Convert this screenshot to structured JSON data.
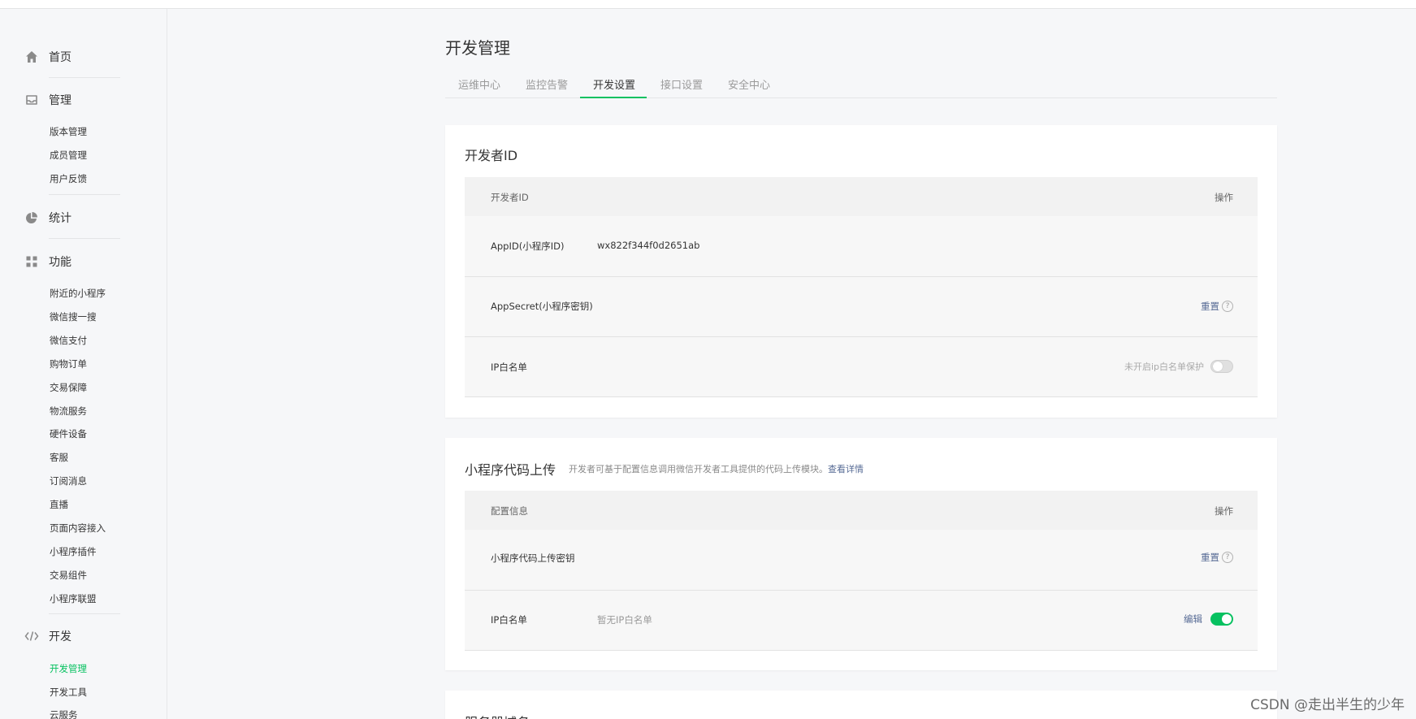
{
  "colors": {
    "accent": "#07c160",
    "link": "#576b95",
    "background": "#f6f7f9"
  },
  "sidebar": {
    "home": {
      "label": "首页",
      "icon": "home-icon"
    },
    "manage": {
      "label": "管理",
      "icon": "inbox-icon",
      "items": [
        "版本管理",
        "成员管理",
        "用户反馈"
      ]
    },
    "stats": {
      "label": "统计",
      "icon": "pie-chart-icon"
    },
    "features": {
      "label": "功能",
      "icon": "grid-icon",
      "items": [
        "附近的小程序",
        "微信搜一搜",
        "微信支付",
        "购物订单",
        "交易保障",
        "物流服务",
        "硬件设备",
        "客服",
        "订阅消息",
        "直播",
        "页面内容接入",
        "小程序插件",
        "交易组件",
        "小程序联盟"
      ]
    },
    "develop": {
      "label": "开发",
      "icon": "code-icon",
      "items": [
        "开发管理",
        "开发工具",
        "云服务"
      ]
    }
  },
  "main": {
    "title": "开发管理",
    "tabs": [
      "运维中心",
      "监控告警",
      "开发设置",
      "接口设置",
      "安全中心"
    ],
    "active_tab": "开发设置",
    "developer_card": {
      "title": "开发者ID",
      "header": {
        "col1": "开发者ID",
        "col2": "操作"
      },
      "rows": {
        "appid": {
          "label": "AppID(小程序ID)",
          "value": "wx822f344f0d2651ab"
        },
        "secret": {
          "label": "AppSecret(小程序密钥)",
          "action": "重置"
        },
        "ip": {
          "label": "IP白名单",
          "hint": "未开启ip白名单保护",
          "toggle": "off"
        }
      }
    },
    "upload_card": {
      "title": "小程序代码上传",
      "desc": "开发者可基于配置信息调用微信开发者工具提供的代码上传模块。",
      "desc_link": "查看详情",
      "header": {
        "col1": "配置信息",
        "col2": "操作"
      },
      "rows": {
        "key": {
          "label": "小程序代码上传密钥",
          "action": "重置"
        },
        "ip": {
          "label": "IP白名单",
          "value": "暂无IP白名单",
          "action": "编辑",
          "toggle": "on"
        }
      }
    },
    "server_card": {
      "title": "服务器域名"
    }
  },
  "help_glyph": "?",
  "watermark": "CSDN @走出半生的少年"
}
